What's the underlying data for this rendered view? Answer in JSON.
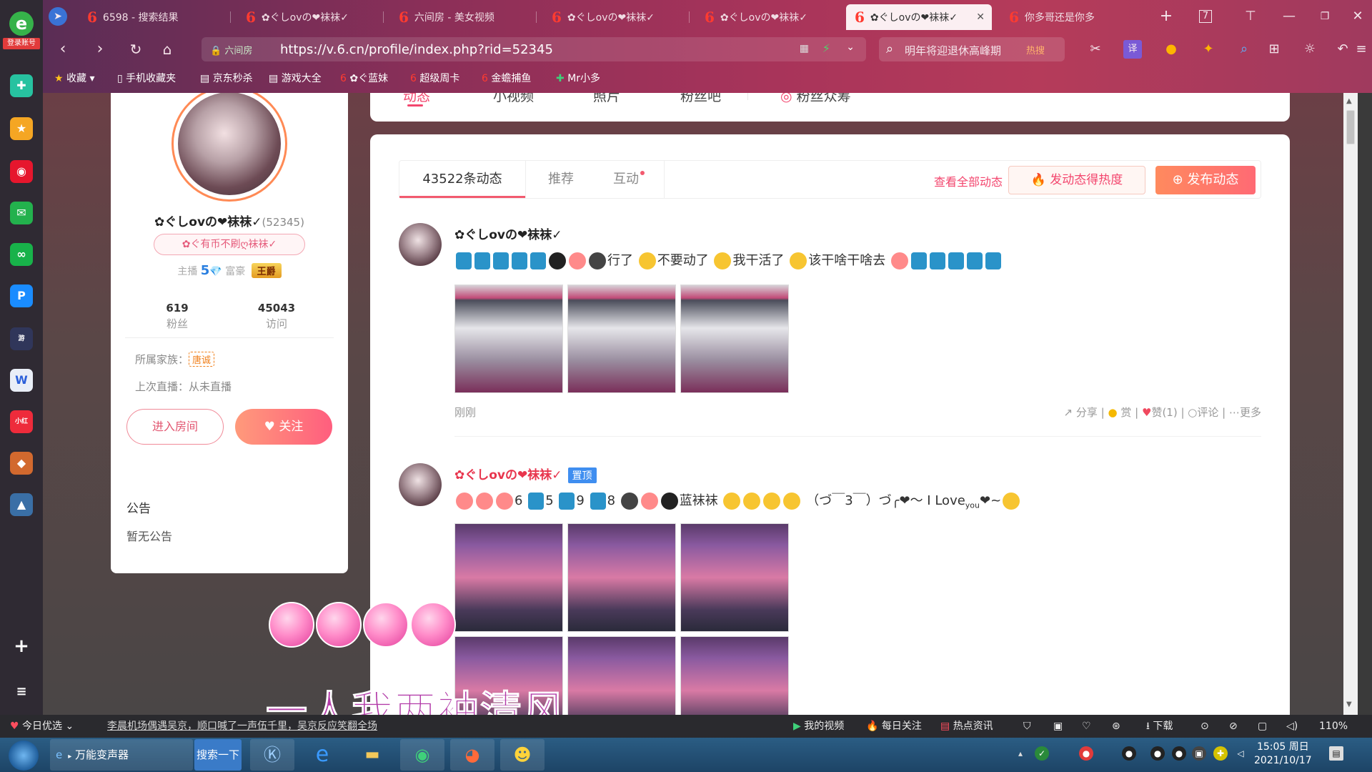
{
  "browser": {
    "sidebar_logo_label": "登录账号",
    "tabs": [
      {
        "label": "6598 - 搜索结果",
        "active": false
      },
      {
        "label": "✿ぐしovの❤袜袜✓",
        "active": false
      },
      {
        "label": "六间房 - 美女视频",
        "active": false
      },
      {
        "label": "✿ぐしovの❤袜袜✓",
        "active": false
      },
      {
        "label": "✿ぐしovの❤袜袜✓",
        "active": false
      },
      {
        "label": "✿ぐしovの❤袜袜✓",
        "active": true
      },
      {
        "label": "你多哥还是你多",
        "active": false
      }
    ],
    "tab_counter": "7",
    "address_secure_label": "六间房",
    "url": "https://v.6.cn/profile/index.php?rid=52345",
    "search_text": "明年将迎退休高峰期",
    "search_hot": "热搜",
    "bookmarks": [
      "收藏",
      "手机收藏夹",
      "京东秒杀",
      "游戏大全",
      "✿ぐ蓝妹",
      "超级周卡",
      "金蟾捕鱼",
      "Mr小多"
    ]
  },
  "profile": {
    "name": "✿ぐしovの❤袜袜✓",
    "id": "(52345)",
    "badge": "✿ぐ有币不刷ღ袜袜✓",
    "level_label_anchor": "主播",
    "level_anchor": "5",
    "level_label_rich": "富豪",
    "rich_title": "王爵",
    "stats": [
      {
        "value": "619",
        "label": "粉丝"
      },
      {
        "value": "45043",
        "label": "访问"
      }
    ],
    "family_label": "所属家族：",
    "family_tag": "唐诚",
    "last_live": "上次直播：从未直播",
    "enter_room": "进入房间",
    "follow": "关注"
  },
  "notice": {
    "title": "公告",
    "body": "暂无公告"
  },
  "top_nav": [
    "动态",
    "小视频",
    "照片",
    "粉丝吧",
    "粉丝众筹"
  ],
  "feed": {
    "tabs": [
      {
        "label": "43522条动态",
        "active": true
      },
      {
        "label": "推荐",
        "active": false
      },
      {
        "label": "互动",
        "active": false
      }
    ],
    "view_all": "查看全部动态",
    "hot_btn": "发动态得热度",
    "post_btn": "发布动态",
    "posts": [
      {
        "author": "✿ぐしovの❤袜袜✓",
        "text_parts": [
          "行了",
          "不要动了",
          "我干活了",
          "该干啥干啥去"
        ],
        "time": "刚刚",
        "actions": {
          "share": "分享",
          "reward": "赏",
          "like": "赞(1)",
          "comment": "评论",
          "more": "更多"
        }
      },
      {
        "author": "✿ぐしovの❤袜袜✓",
        "pinned": "置顶",
        "text_parts": [
          "6",
          "5",
          "9",
          "8",
          "蓝袜袜",
          "（づ￣3￣）づ╭❤～ I Love",
          "you",
          "❤~"
        ]
      }
    ]
  },
  "overlay_caption": "一人我两袖清风",
  "statusbar": {
    "daily": "今日优选",
    "headline": "李晨机场偶遇吴京，顺口喊了一声伍千里，吴京反应笑翻全场",
    "items": [
      "我的视频",
      "每日关注",
      "热点资讯",
      "下载"
    ],
    "zoom": "110%"
  },
  "taskbar": {
    "app": "万能变声器",
    "search": "搜索一下",
    "time": "15:05 周日",
    "date": "2021/10/17"
  }
}
